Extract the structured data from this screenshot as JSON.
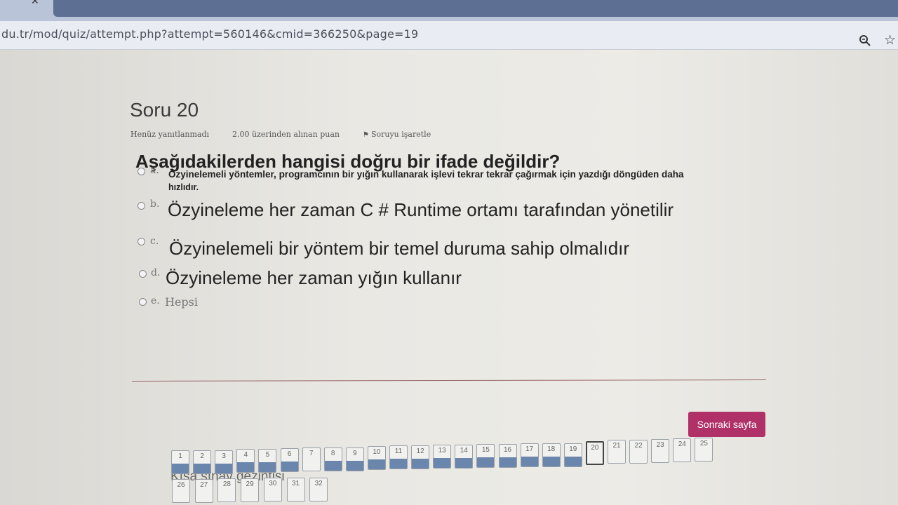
{
  "browser": {
    "url": "du.tr/mod/quiz/attempt.php?attempt=560146&cmid=366250&page=19"
  },
  "question": {
    "title": "Soru 20",
    "status": "Henüz yanıtlanmadı",
    "points": "2.00 üzerinden alınan puan",
    "flag_label": "Soruyu işaretle",
    "text": "Aşağıdakilerden hangisi doğru bir ifade değildir?",
    "options": [
      {
        "letter": "a.",
        "line1": "Özyinelemeli yöntemler, programcının bir yığın kullanarak işlevi tekrar tekrar çağırmak için yazdığı döngüden daha",
        "line2": "hızlıdır."
      },
      {
        "letter": "b.",
        "text": "Özyineleme her zaman C # Runtime ortamı tarafından yönetilir"
      },
      {
        "letter": "c.",
        "text": "Özyinelemeli bir yöntem bir temel duruma sahip olmalıdır"
      },
      {
        "letter": "d.",
        "text": "Özyineleme her zaman yığın kullanır"
      },
      {
        "letter": "e.",
        "text": "Hepsi"
      }
    ]
  },
  "next_button": "Sonraki sayfa",
  "quiz_nav": {
    "title": "Kısa sınav gezintisi",
    "current": 20,
    "answered": [
      1,
      2,
      3,
      4,
      5,
      6,
      8,
      9,
      10,
      11,
      12,
      13,
      14,
      15,
      16,
      17,
      18,
      19
    ],
    "buttons": [
      "1",
      "2",
      "3",
      "4",
      "5",
      "6",
      "7",
      "8",
      "9",
      "10",
      "11",
      "12",
      "13",
      "14",
      "15",
      "16",
      "17",
      "18",
      "19",
      "20",
      "21",
      "22",
      "23",
      "24",
      "25",
      "26",
      "27",
      "28",
      "29",
      "30",
      "31",
      "32"
    ]
  },
  "icons": {
    "search": "zoom-icon",
    "bookmark": "star-icon",
    "flag": "flag-icon"
  }
}
